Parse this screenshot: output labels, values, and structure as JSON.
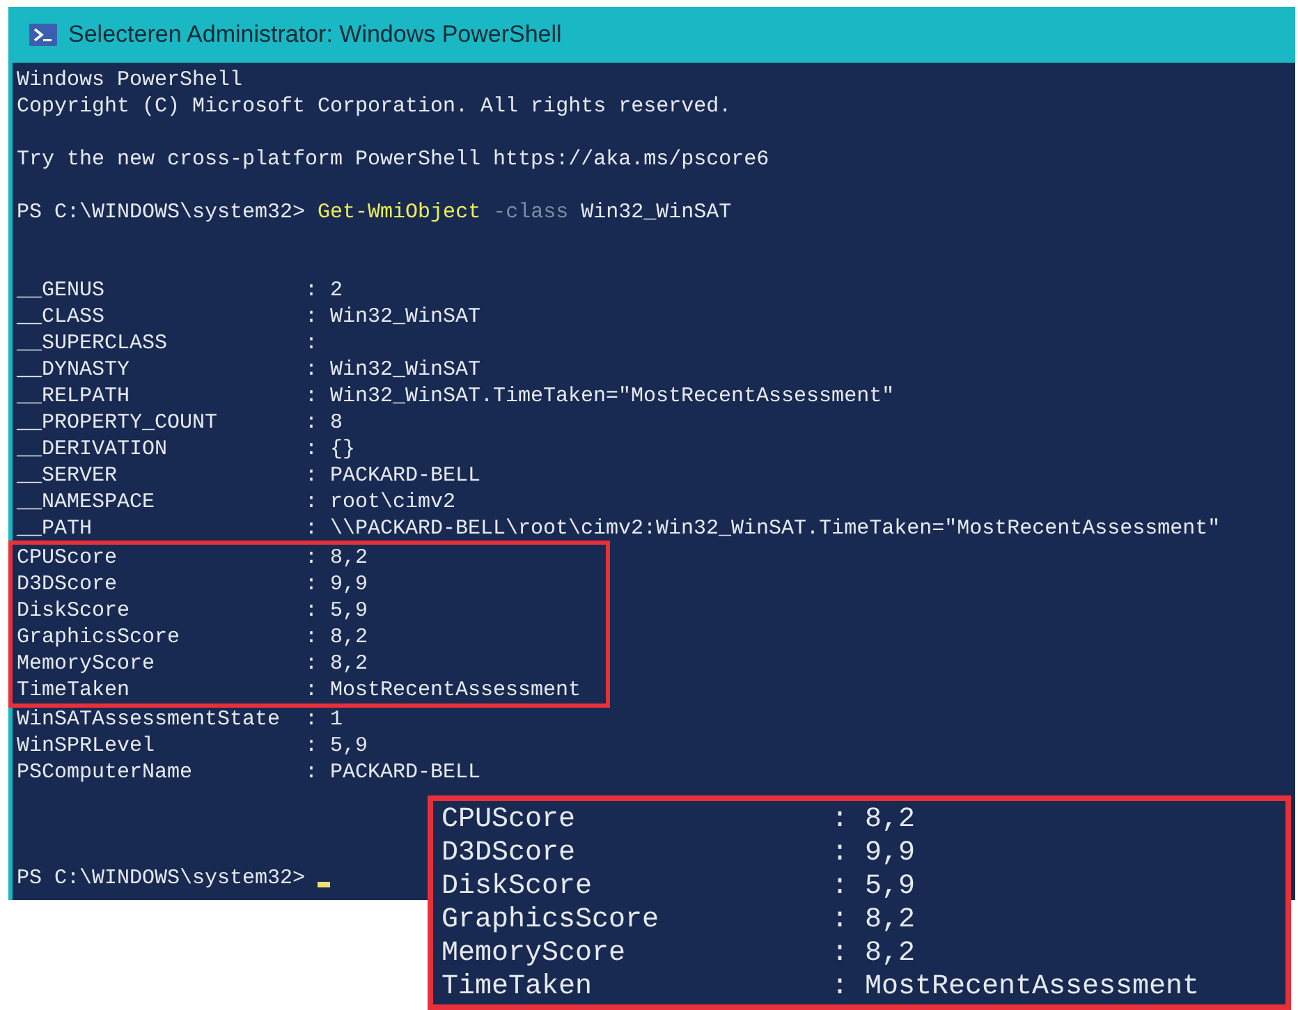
{
  "window": {
    "title": "Selecteren Administrator: Windows PowerShell"
  },
  "banner": [
    "Windows PowerShell",
    "Copyright (C) Microsoft Corporation. All rights reserved.",
    "Try the new cross-platform PowerShell https://aka.ms/pscore6"
  ],
  "prompt": "PS C:\\WINDOWS\\system32>",
  "command": [
    {
      "kind": "cmdlet",
      "text": "Get-WmiObject"
    },
    {
      "kind": "parameter",
      "text": "-class"
    },
    {
      "kind": "argument",
      "text": "Win32_WinSAT"
    }
  ],
  "separator": ":",
  "properties": [
    {
      "name": "__GENUS",
      "value": "2",
      "highlighted": false
    },
    {
      "name": "__CLASS",
      "value": "Win32_WinSAT",
      "highlighted": false
    },
    {
      "name": "__SUPERCLASS",
      "highlighted": false
    },
    {
      "name": "__DYNASTY",
      "value": "Win32_WinSAT",
      "highlighted": false
    },
    {
      "name": "__RELPATH",
      "value": "Win32_WinSAT.TimeTaken=\"MostRecentAssessment\"",
      "highlighted": false
    },
    {
      "name": "__PROPERTY_COUNT",
      "value": "8",
      "highlighted": false
    },
    {
      "name": "__DERIVATION",
      "value": "{}",
      "highlighted": false
    },
    {
      "name": "__SERVER",
      "value": "PACKARD-BELL",
      "highlighted": false
    },
    {
      "name": "__NAMESPACE",
      "value": "root\\cimv2",
      "highlighted": false
    },
    {
      "name": "__PATH",
      "value": "\\\\PACKARD-BELL\\root\\cimv2:Win32_WinSAT.TimeTaken=\"MostRecentAssessment\"",
      "highlighted": false
    },
    {
      "name": "CPUScore",
      "value": "8,2",
      "highlighted": true
    },
    {
      "name": "D3DScore",
      "value": "9,9",
      "highlighted": true
    },
    {
      "name": "DiskScore",
      "value": "5,9",
      "highlighted": true
    },
    {
      "name": "GraphicsScore",
      "value": "8,2",
      "highlighted": true
    },
    {
      "name": "MemoryScore",
      "value": "8,2",
      "highlighted": true
    },
    {
      "name": "TimeTaken",
      "value": "MostRecentAssessment",
      "highlighted": true
    },
    {
      "name": "WinSATAssessmentState",
      "value": "1",
      "highlighted": false
    },
    {
      "name": "WinSPRLevel",
      "value": "5,9",
      "highlighted": false
    },
    {
      "name": "PSComputerName",
      "value": "PACKARD-BELL",
      "highlighted": false
    }
  ],
  "final_prompt": "PS C:\\WINDOWS\\system32>",
  "zoom_inset": [
    {
      "name": "CPUScore",
      "value": "8,2"
    },
    {
      "name": "D3DScore",
      "value": "9,9"
    },
    {
      "name": "DiskScore",
      "value": "5,9"
    },
    {
      "name": "GraphicsScore",
      "value": "8,2"
    },
    {
      "name": "MemoryScore",
      "value": "8,2"
    },
    {
      "name": "TimeTaken",
      "value": "MostRecentAssessment"
    }
  ]
}
